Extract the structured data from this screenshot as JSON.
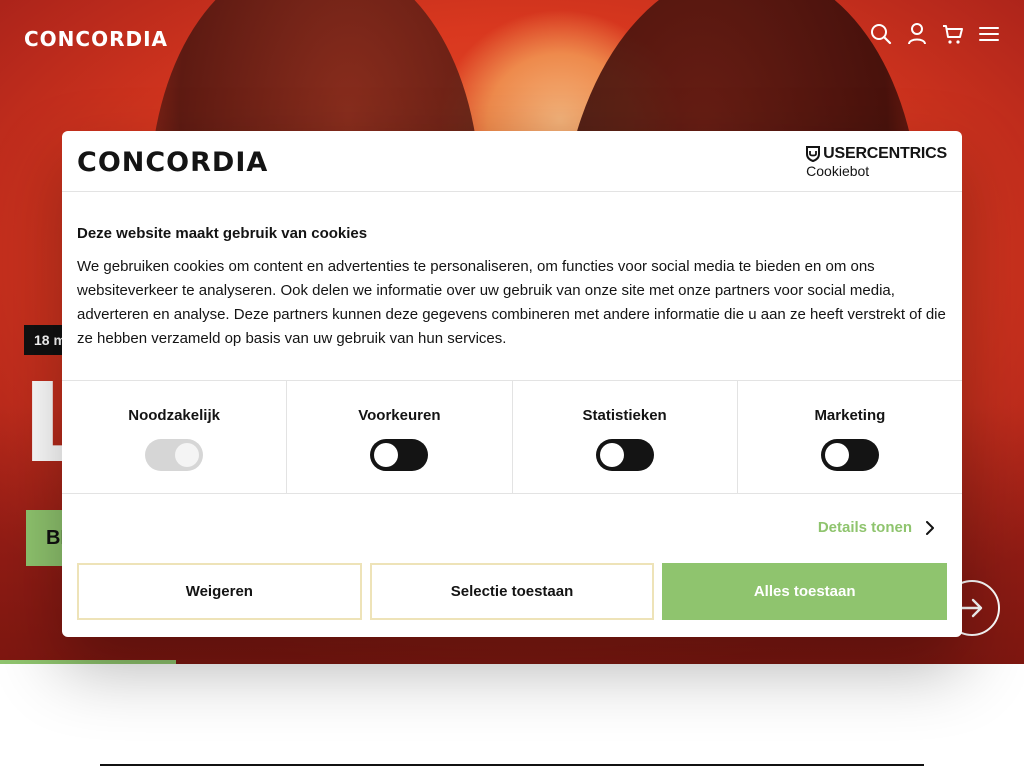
{
  "site": {
    "logo_text": "CONCORDIA"
  },
  "header": {
    "icons": [
      "search-icon",
      "account-icon",
      "cart-icon",
      "menu-icon"
    ]
  },
  "hero": {
    "badge": "18 m",
    "title": "L",
    "cta_label": "BE",
    "progress_fraction": 0.17
  },
  "cookie_dialog": {
    "logo_text": "CONCORDIA",
    "provider": {
      "brand": "USERCENTRICS",
      "product": "Cookiebot"
    },
    "title": "Deze website maakt gebruik van cookies",
    "text": "We gebruiken cookies om content en advertenties te personaliseren, om functies voor social media te bieden en om ons websiteverkeer te analyseren. Ook delen we informatie over uw gebruik van onze site met onze partners voor social media, adverteren en analyse. Deze partners kunnen deze gegevens combineren met andere informatie die u aan ze heeft verstrekt of die ze hebben verzameld op basis van uw gebruik van hun services.",
    "categories": [
      {
        "label": "Noodzakelijk",
        "checked": true,
        "disabled": true
      },
      {
        "label": "Voorkeuren",
        "checked": false,
        "disabled": false
      },
      {
        "label": "Statistieken",
        "checked": false,
        "disabled": false
      },
      {
        "label": "Marketing",
        "checked": false,
        "disabled": false
      }
    ],
    "details_label": "Details tonen",
    "buttons": {
      "decline": "Weigeren",
      "allow_selection": "Selectie toestaan",
      "allow_all": "Alles toestaan"
    }
  },
  "colors": {
    "accent_green": "#8fc46e",
    "button_border": "#eee3b8",
    "text": "#141414"
  }
}
